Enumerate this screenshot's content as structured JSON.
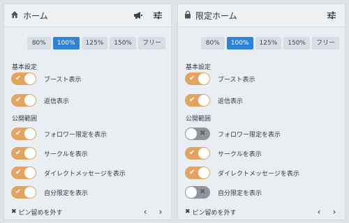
{
  "columns": [
    {
      "id": "home",
      "title": "ホーム",
      "header_icon": "home-icon",
      "show_announcement_icon": true,
      "zoom": [
        "80%",
        "100%",
        "125%",
        "150%",
        "フリー"
      ],
      "zoom_selected": "100%",
      "section_basic": "基本設定",
      "basic_toggles": [
        {
          "label": "ブースト表示",
          "on": true
        },
        {
          "label": "返信表示",
          "on": true
        }
      ],
      "section_visibility": "公開範囲",
      "visibility_toggles": [
        {
          "label": "フォロワー限定を表示",
          "on": true
        },
        {
          "label": "サークルを表示",
          "on": true
        },
        {
          "label": "ダイレクトメッセージを表示",
          "on": true
        },
        {
          "label": "自分限定を表示",
          "on": true
        }
      ],
      "unpin": "ピン留めを外す"
    },
    {
      "id": "limited-home",
      "title": "限定ホーム",
      "header_icon": "lock-icon",
      "show_announcement_icon": false,
      "zoom": [
        "80%",
        "100%",
        "125%",
        "150%",
        "フリー"
      ],
      "zoom_selected": "100%",
      "section_basic": "基本設定",
      "basic_toggles": [
        {
          "label": "ブースト表示",
          "on": true
        },
        {
          "label": "返信表示",
          "on": true
        }
      ],
      "section_visibility": "公開範囲",
      "visibility_toggles": [
        {
          "label": "フォロワー限定を表示",
          "on": false
        },
        {
          "label": "サークルを表示",
          "on": true
        },
        {
          "label": "ダイレクトメッセージを表示",
          "on": true
        },
        {
          "label": "自分限定を表示",
          "on": false
        }
      ],
      "unpin": "ピン留めを外す"
    }
  ],
  "colors": {
    "toggle_on": "#e3a45f",
    "toggle_off": "#8e959c",
    "zoom_active": "#2f82d6"
  }
}
